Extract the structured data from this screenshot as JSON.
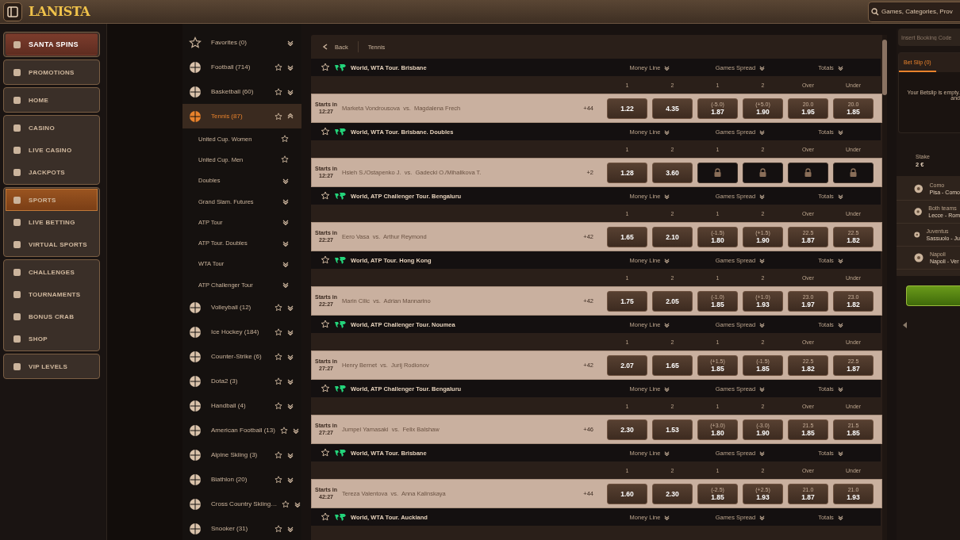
{
  "topbar": {
    "logo": "LANISTA",
    "search": {
      "placeholder": "Games, Categories, Prov"
    }
  },
  "nav": {
    "groups": [
      {
        "items": [
          {
            "label": "SANTA SPINS",
            "kind": "featured",
            "selected": false
          }
        ]
      },
      {
        "items": [
          {
            "label": "PROMOTIONS",
            "kind": "normal",
            "selected": false
          }
        ]
      },
      {
        "items": [
          {
            "label": "HOME",
            "kind": "normal",
            "selected": false
          }
        ]
      },
      {
        "items": [
          {
            "label": "CASINO",
            "kind": "normal",
            "selected": false
          },
          {
            "label": "LIVE CASINO",
            "kind": "normal",
            "selected": false
          },
          {
            "label": "JACKPOTS",
            "kind": "normal",
            "selected": false
          }
        ]
      },
      {
        "items": [
          {
            "label": "SPORTS",
            "kind": "normal",
            "selected": true
          },
          {
            "label": "LIVE BETTING",
            "kind": "normal",
            "selected": false
          },
          {
            "label": "VIRTUAL SPORTS",
            "kind": "normal",
            "selected": false
          }
        ]
      },
      {
        "items": [
          {
            "label": "CHALLENGES",
            "kind": "normal",
            "selected": false
          },
          {
            "label": "TOURNAMENTS",
            "kind": "normal",
            "selected": false
          },
          {
            "label": "BONUS CRAB",
            "kind": "normal",
            "selected": false
          },
          {
            "label": "SHOP",
            "kind": "normal",
            "selected": false
          }
        ]
      },
      {
        "items": [
          {
            "label": "VIP LEVELS",
            "kind": "normal",
            "selected": false
          }
        ]
      }
    ]
  },
  "sports": [
    {
      "label": "Favorites (0)",
      "kind": "favorites",
      "selected": false,
      "expanded": false
    },
    {
      "label": "Football (714)",
      "kind": "sport",
      "selected": false,
      "expanded": false
    },
    {
      "label": "Basketball (60)",
      "kind": "sport",
      "selected": false,
      "expanded": false
    },
    {
      "label": "Tennis (87)",
      "kind": "sport",
      "selected": true,
      "expanded": true,
      "children": [
        {
          "label": "United Cup. Women",
          "kind": "league"
        },
        {
          "label": "United Cup. Men",
          "kind": "league"
        },
        {
          "label": "Doubles",
          "kind": "group"
        },
        {
          "label": "Grand Slam. Futures",
          "kind": "group"
        },
        {
          "label": "ATP Tour",
          "kind": "group"
        },
        {
          "label": "ATP Tour. Doubles",
          "kind": "group"
        },
        {
          "label": "WTA Tour",
          "kind": "group"
        },
        {
          "label": "ATP Challenger Tour",
          "kind": "group"
        }
      ]
    },
    {
      "label": "Volleyball (12)",
      "kind": "sport",
      "selected": false,
      "expanded": false
    },
    {
      "label": "Ice Hockey (184)",
      "kind": "sport",
      "selected": false,
      "expanded": false
    },
    {
      "label": "Counter-Strike (6)",
      "kind": "sport",
      "selected": false,
      "expanded": false
    },
    {
      "label": "Dota2 (3)",
      "kind": "sport",
      "selected": false,
      "expanded": false
    },
    {
      "label": "Handball (4)",
      "kind": "sport",
      "selected": false,
      "expanded": false
    },
    {
      "label": "American Football (13)",
      "kind": "sport",
      "selected": false,
      "expanded": false
    },
    {
      "label": "Alpine Skiing (3)",
      "kind": "sport",
      "selected": false,
      "expanded": false
    },
    {
      "label": "Biathlon (20)",
      "kind": "sport",
      "selected": false,
      "expanded": false
    },
    {
      "label": "Cross Country Skiing…",
      "kind": "sport",
      "selected": false,
      "expanded": false
    },
    {
      "label": "Snooker (31)",
      "kind": "sport",
      "selected": false,
      "expanded": false
    }
  ],
  "main": {
    "breadcrumb": {
      "back": "Back",
      "current": "Tennis"
    },
    "leagues": [
      {
        "name": "World, WTA Tour. Brisbane",
        "markets": [
          "Money Line",
          "Games Spread",
          "Totals"
        ],
        "columns": [
          "1",
          "2",
          "1",
          "2",
          "Over",
          "Under"
        ],
        "match": {
          "starts": "Starts in 12:27",
          "teams": "Marketa Vondrousova  vs.  Magdalena Frech",
          "more": "+44",
          "odds": [
            {
              "kind": "price",
              "price": "1.22"
            },
            {
              "kind": "price",
              "price": "4.35"
            },
            {
              "kind": "price",
              "line": "(-5.0)",
              "price": "1.87"
            },
            {
              "kind": "price",
              "line": "(+5.0)",
              "price": "1.90"
            },
            {
              "kind": "price",
              "line": "20.0",
              "price": "1.95"
            },
            {
              "kind": "price",
              "line": "20.0",
              "price": "1.85"
            }
          ]
        }
      },
      {
        "name": "World, WTA Tour. Brisbane. Doubles",
        "markets": [
          "Money Line",
          "Games Spread",
          "Totals"
        ],
        "columns": [
          "1",
          "2",
          "1",
          "2",
          "Over",
          "Under"
        ],
        "match": {
          "starts": "Starts in 12:27",
          "teams": "Hsieh S./Ostapenko J.  vs.  Gadecki O./Mihalikova T.",
          "more": "+2",
          "odds": [
            {
              "kind": "price",
              "price": "1.28"
            },
            {
              "kind": "price",
              "price": "3.60"
            },
            {
              "kind": "locked"
            },
            {
              "kind": "locked"
            },
            {
              "kind": "locked"
            },
            {
              "kind": "locked"
            }
          ]
        }
      },
      {
        "name": "World, ATP Challenger Tour. Bengaluru",
        "markets": [
          "Money Line",
          "Games Spread",
          "Totals"
        ],
        "columns": [
          "1",
          "2",
          "1",
          "2",
          "Over",
          "Under"
        ],
        "match": {
          "starts": "Starts in 22:27",
          "teams": "Eero Vasa  vs.  Arthur Reymond",
          "more": "+42",
          "odds": [
            {
              "kind": "price",
              "price": "1.65"
            },
            {
              "kind": "price",
              "price": "2.10"
            },
            {
              "kind": "price",
              "line": "(-1.5)",
              "price": "1.80"
            },
            {
              "kind": "price",
              "line": "(+1.5)",
              "price": "1.90"
            },
            {
              "kind": "price",
              "line": "22.5",
              "price": "1.87"
            },
            {
              "kind": "price",
              "line": "22.5",
              "price": "1.82"
            }
          ]
        }
      },
      {
        "name": "World, ATP Tour. Hong Kong",
        "markets": [
          "Money Line",
          "Games Spread",
          "Totals"
        ],
        "columns": [
          "1",
          "2",
          "1",
          "2",
          "Over",
          "Under"
        ],
        "match": {
          "starts": "Starts in 22:27",
          "teams": "Marin Cilic  vs.  Adrian Mannarino",
          "more": "+42",
          "odds": [
            {
              "kind": "price",
              "price": "1.75"
            },
            {
              "kind": "price",
              "price": "2.05"
            },
            {
              "kind": "price",
              "line": "(-1.0)",
              "price": "1.85"
            },
            {
              "kind": "price",
              "line": "(+1.0)",
              "price": "1.93"
            },
            {
              "kind": "price",
              "line": "23.0",
              "price": "1.97"
            },
            {
              "kind": "price",
              "line": "23.0",
              "price": "1.82"
            }
          ]
        }
      },
      {
        "name": "World, ATP Challenger Tour. Noumea",
        "markets": [
          "Money Line",
          "Games Spread",
          "Totals"
        ],
        "columns": [
          "1",
          "2",
          "1",
          "2",
          "Over",
          "Under"
        ],
        "match": {
          "starts": "Starts in 27:27",
          "teams": "Henry Bernet  vs.  Jurij Rodionov",
          "more": "+42",
          "odds": [
            {
              "kind": "price",
              "price": "2.07"
            },
            {
              "kind": "price",
              "price": "1.65"
            },
            {
              "kind": "price",
              "line": "(+1.5)",
              "price": "1.85"
            },
            {
              "kind": "price",
              "line": "(-1.5)",
              "price": "1.85"
            },
            {
              "kind": "price",
              "line": "22.5",
              "price": "1.82"
            },
            {
              "kind": "price",
              "line": "22.5",
              "price": "1.87"
            }
          ]
        }
      },
      {
        "name": "World, ATP Challenger Tour. Bengaluru",
        "markets": [
          "Money Line",
          "Games Spread",
          "Totals"
        ],
        "columns": [
          "1",
          "2",
          "1",
          "2",
          "Over",
          "Under"
        ],
        "match": {
          "starts": "Starts in 27:27",
          "teams": "Jumpei Yamasaki  vs.  Felix Balshaw",
          "more": "+46",
          "odds": [
            {
              "kind": "price",
              "price": "2.30"
            },
            {
              "kind": "price",
              "price": "1.53"
            },
            {
              "kind": "price",
              "line": "(+3.0)",
              "price": "1.80"
            },
            {
              "kind": "price",
              "line": "(-3.0)",
              "price": "1.90"
            },
            {
              "kind": "price",
              "line": "21.5",
              "price": "1.85"
            },
            {
              "kind": "price",
              "line": "21.5",
              "price": "1.85"
            }
          ]
        }
      },
      {
        "name": "World, WTA Tour. Brisbane",
        "markets": [
          "Money Line",
          "Games Spread",
          "Totals"
        ],
        "columns": [
          "1",
          "2",
          "1",
          "2",
          "Over",
          "Under"
        ],
        "match": {
          "starts": "Starts in 42:27",
          "teams": "Tereza Valentova  vs.  Anna Kalinskaya",
          "more": "+44",
          "odds": [
            {
              "kind": "price",
              "price": "1.60"
            },
            {
              "kind": "price",
              "price": "2.30"
            },
            {
              "kind": "price",
              "line": "(-2.5)",
              "price": "1.85"
            },
            {
              "kind": "price",
              "line": "(+2.5)",
              "price": "1.93"
            },
            {
              "kind": "price",
              "line": "21.0",
              "price": "1.87"
            },
            {
              "kind": "price",
              "line": "21.0",
              "price": "1.93"
            }
          ]
        }
      },
      {
        "name": "World, WTA Tour. Auckland",
        "markets": [
          "Money Line",
          "Games Spread",
          "Totals"
        ]
      }
    ]
  },
  "betslip": {
    "booking": {
      "placeholder": "Insert Booking Code"
    },
    "tabs": [
      {
        "label": "Bet Slip (0)",
        "selected": true
      }
    ],
    "empty": "Your Betslip is empty. and",
    "stake": {
      "label": "Stake",
      "value": "2 €"
    },
    "bets": [
      {
        "market": "Como",
        "match": "Pisa - Como"
      },
      {
        "market": "Both teams",
        "match": "Lecce - Rom"
      },
      {
        "market": "Juventus",
        "match": "Sassuolo - Ju"
      },
      {
        "market": "Napoli",
        "match": "Napoli - Ver"
      }
    ]
  }
}
